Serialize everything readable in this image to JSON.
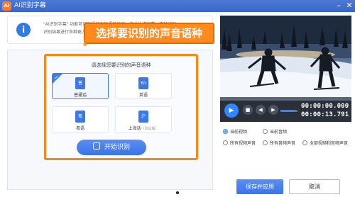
{
  "window": {
    "app_logo_text": "AI",
    "title": "AI识别字幕",
    "minimize_icon": "minimize-icon",
    "close_icon": "close-icon"
  },
  "notice": {
    "icon": "info-icon",
    "line1": "\"AI识别字幕\" 功能可识别视频中的语音内容，自动生成字幕，支持识别",
    "line2": "识别结果进行各种更人性"
  },
  "callout": {
    "text": "选择要识别的声音语种",
    "arrow": "↓"
  },
  "language_panel": {
    "title": "请选择您要识别的声音语种",
    "options": [
      {
        "label": "普通话",
        "icon_text": "普",
        "selected": true
      },
      {
        "label": "英语",
        "icon_text": "En",
        "selected": false
      },
      {
        "label": "粤语",
        "icon_text": "粤",
        "selected": false
      },
      {
        "label": "上海话",
        "sublabel": "（测试版）",
        "icon_text": "沪",
        "selected": false
      }
    ],
    "start_button": "开始识别"
  },
  "player": {
    "progress_fraction": 0.0,
    "volume_fraction": 0.85,
    "current_time": "00:00:00.000",
    "total_time": "00:00:13.791",
    "controls": {
      "play": "▶",
      "stop": "■",
      "prev": "◀",
      "next": "▶",
      "volume": "🔊"
    }
  },
  "scope_options": [
    {
      "label": "当前视频",
      "checked": true
    },
    {
      "label": "当前音频",
      "checked": false
    },
    {
      "label": "所有视频声音",
      "checked": false
    },
    {
      "label": "所有音频声音",
      "checked": false
    },
    {
      "label": "全部视频和音频声音",
      "checked": false
    }
  ],
  "footer": {
    "save_label": "保存并应用",
    "cancel_label": "取消"
  },
  "colors": {
    "titlebar": "#3b66c4",
    "accent": "#2f7be7",
    "highlight_orange": "#f28a19"
  }
}
